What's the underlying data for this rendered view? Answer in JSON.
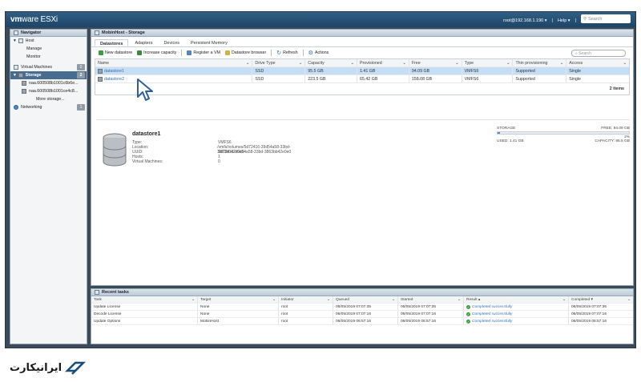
{
  "topbar": {
    "logo_vm": "vm",
    "logo_ware": "ware",
    "logo_esxi": " ESXi",
    "user": "root@192.168.1.190 ▾",
    "sep1": "|",
    "help": "Help ▾",
    "sep2": "|",
    "search_placeholder": "Search"
  },
  "navigator": {
    "title": "Navigator",
    "host": "Host",
    "manage": "Manage",
    "monitor": "Monitor",
    "virtual_machines": "Virtual Machines",
    "vm_count": "0",
    "storage": "Storage",
    "storage_count": "2",
    "disk1": "naa.600508b1001c6b6e...",
    "disk2": "naa.600508b1001ce4c8...",
    "more_storage": "More storage...",
    "networking": "Networking",
    "net_count": "1"
  },
  "main": {
    "title": "MobinHost - Storage",
    "tabs": [
      "Datastores",
      "Adapters",
      "Devices",
      "Persistent Memory"
    ],
    "toolbar": {
      "new_datastore": "New datastore",
      "increase_capacity": "Increase capacity",
      "register_vm": "Register a VM",
      "datastore_browser": "Datastore browser",
      "refresh": "Refresh",
      "actions": "Actions",
      "search_placeholder": "Search"
    },
    "columns": [
      "Name",
      "Drive Type",
      "Capacity",
      "Provisioned",
      "Free",
      "Type",
      "Thin provisioning",
      "Access"
    ],
    "rows": [
      [
        "datastore1",
        "SSD",
        "95.5 GB",
        "1.41 GB",
        "94.09 GB",
        "VMFS6",
        "Supported",
        "Single"
      ],
      [
        "datastore2",
        "SSD",
        "223.5 GB",
        "65.42 GB",
        "158.08 GB",
        "VMFS6",
        "Supported",
        "Single"
      ]
    ],
    "footer": "2 items"
  },
  "details": {
    "name": "datastore1",
    "labels": [
      "Type:",
      "Location:",
      "UUID:",
      "Hosts:",
      "Virtual Machines:"
    ],
    "values": [
      "VMFS6",
      "/vmfs/volumes/5d72416-39d54a58-33bd-3863bb42e0e0",
      "5d72416-39d54a58-33bd-3863bb42e0e0",
      "1",
      "0"
    ],
    "storage_label": "STORAGE",
    "free": "FREE: 94.09 GB",
    "percent": "2%",
    "used": "USED: 1.41 GB",
    "capacity": "CAPACITY: 95.5 GB",
    "used_fraction": 0.02
  },
  "tasks": {
    "title": "Recent tasks",
    "columns": [
      "Task",
      "Target",
      "Initiator",
      "Queued",
      "Started",
      "Result ▴",
      "Completed ▾"
    ],
    "rows": [
      [
        "Update License",
        "None",
        "root",
        "06/05/2019 07:07:35",
        "06/05/2019 07:07:35",
        "Completed successfully",
        "06/05/2019 07:07:36"
      ],
      [
        "Decode License",
        "None",
        "root",
        "06/05/2019 07:07:16",
        "06/05/2019 07:07:16",
        "Completed successfully",
        "06/05/2019 07:07:16"
      ],
      [
        "Update Options",
        "MobinHost",
        "root",
        "06/05/2019 06:57:16",
        "06/05/2019 06:57:16",
        "Completed successfully",
        "06/05/2019 06:57:16"
      ]
    ]
  },
  "brand": {
    "text": "ایرانیکارت"
  },
  "colors": {
    "topbar": "#1d4567",
    "selection": "#c6def5",
    "nav_selected": "#476c90",
    "success": "#3aa13a"
  }
}
